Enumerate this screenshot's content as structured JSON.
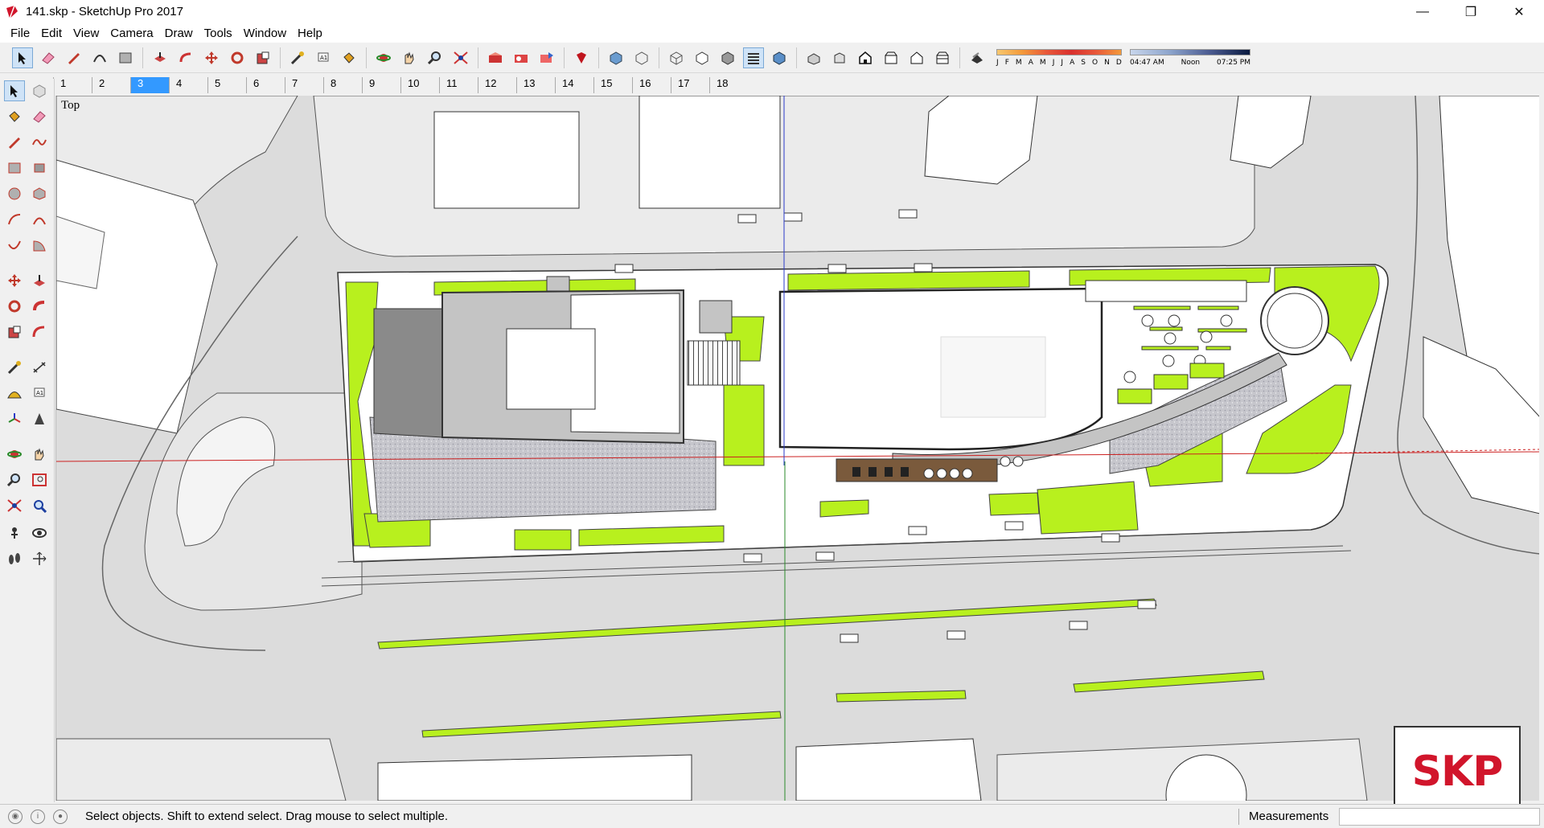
{
  "window": {
    "title": "141.skp - SketchUp Pro 2017",
    "minimize_glyph": "—",
    "maximize_glyph": "❐",
    "close_glyph": "✕"
  },
  "menu": [
    "File",
    "Edit",
    "View",
    "Camera",
    "Draw",
    "Tools",
    "Window",
    "Help"
  ],
  "toolbar": {
    "tools": [
      "select-icon",
      "eraser-icon",
      "pencil-icon",
      "arc-icon",
      "rectangle-icon",
      "push-pull-icon",
      "follow-me-icon",
      "move-icon",
      "rotate-icon",
      "scale-icon",
      "tape-measure-icon",
      "text-icon",
      "paint-bucket-icon",
      "orbit-icon",
      "pan-icon",
      "zoom-icon",
      "zoom-extents-icon",
      "warehouse-icon",
      "extension-icon",
      "share-model-icon",
      "ruby-icon",
      "xray-icon",
      "back-edges-icon",
      "wireframe-icon",
      "hidden-line-icon",
      "shaded-icon",
      "shaded-textures-icon",
      "monochrome-icon",
      "iso-view-icon",
      "top-view-icon",
      "front-view-icon",
      "right-view-icon",
      "back-view-icon",
      "left-view-icon",
      "shadow-toggle-icon"
    ],
    "shadow_months": [
      "J",
      "F",
      "M",
      "A",
      "M",
      "J",
      "J",
      "A",
      "S",
      "O",
      "N",
      "D"
    ],
    "shadow_time_start": "04:47 AM",
    "shadow_time_mid": "Noon",
    "shadow_time_end": "07:25 PM"
  },
  "scenes": {
    "tabs": [
      "1",
      "2",
      "3",
      "4",
      "5",
      "6",
      "7",
      "8",
      "9",
      "10",
      "11",
      "12",
      "13",
      "14",
      "15",
      "16",
      "17",
      "18"
    ],
    "active": "3"
  },
  "viewport": {
    "camera_label": "Top"
  },
  "badge": {
    "text": "SKP"
  },
  "status": {
    "message": "Select objects. Shift to extend select. Drag mouse to select multiple.",
    "measurements_label": "Measurements",
    "measurements_value": ""
  },
  "colors": {
    "grass": "#b8f01e",
    "paving": "#c8c8cc",
    "road": "#dcdcdc",
    "building_dark": "#8a8a8a",
    "building_mid": "#c4c4c4",
    "axis_red": "#cc2020",
    "axis_green": "#2a8a2a",
    "axis_blue": "#2a3ac8",
    "selection": "#3399ff",
    "skp_red": "#d1152b"
  }
}
